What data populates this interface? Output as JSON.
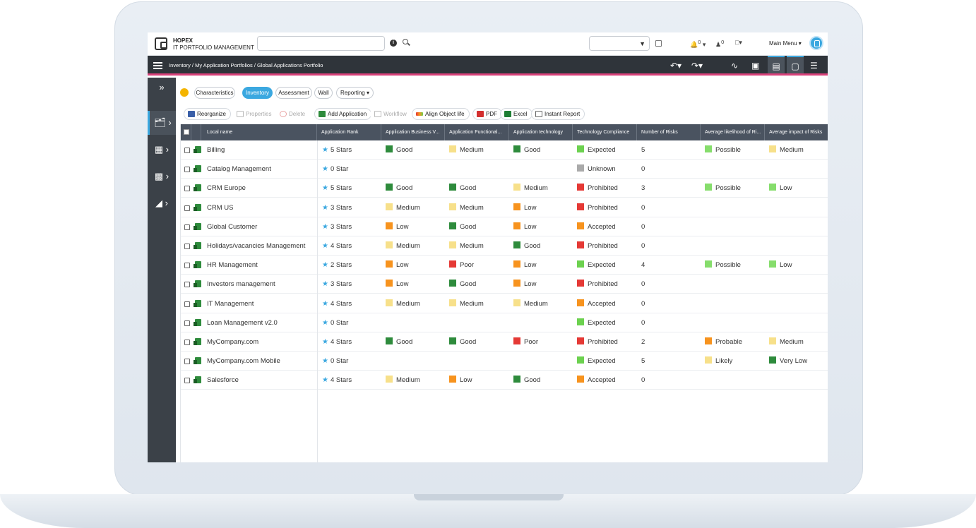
{
  "app": {
    "brand_line1": "HOPEX",
    "brand_line2": "IT PORTFOLIO MANAGEMENT",
    "main_menu": "Main Menu",
    "notif_count": "0",
    "user_count": "0"
  },
  "breadcrumb": "Inventory / My Application Portfolios / Global Applications Portfolio",
  "tabs": [
    {
      "label": "Characteristics"
    },
    {
      "label": "Inventory"
    },
    {
      "label": "Assessment"
    },
    {
      "label": "Wall"
    },
    {
      "label": "Reporting"
    }
  ],
  "toolbar": {
    "reorganize": "Reorganize",
    "properties": "Properties",
    "delete": "Delete",
    "add_application": "Add Application",
    "workflow": "Workflow",
    "align_object_life": "Align Object life",
    "pdf": "PDF",
    "excel": "Excel",
    "instant_report": "Instant Report"
  },
  "columns": [
    "Local name",
    "Application Rank",
    "Application Business V...",
    "Application Functional...",
    "Application technology",
    "Technology Compliance",
    "Number of Risks",
    "Average likelihood of Ri...",
    "Average impact of Risks"
  ],
  "colors": {
    "good": "#2e8b3c",
    "medium": "#f7e08a",
    "low": "#f7931e",
    "poor": "#e53935",
    "expected": "#6cd14f",
    "unknown": "#aaaaaa",
    "prohibited": "#e53935",
    "accepted": "#f7931e",
    "possible": "#86dd6c",
    "probable": "#f7931e",
    "likely": "#f7e08a",
    "very_low": "#2e8b3c",
    "low_impact": "#86dd6c",
    "medium_impact": "#f7e08a"
  },
  "rows": [
    {
      "name": "Billing",
      "rank": "5 Stars",
      "bv": "Good",
      "func": "Medium",
      "tech": "Good",
      "comp": "Expected",
      "risks": "5",
      "lik": "Possible",
      "imp": "Medium"
    },
    {
      "name": "Catalog Management",
      "rank": "0 Star",
      "bv": "",
      "func": "",
      "tech": "",
      "comp": "Unknown",
      "risks": "0",
      "lik": "",
      "imp": ""
    },
    {
      "name": "CRM Europe",
      "rank": "5 Stars",
      "bv": "Good",
      "func": "Good",
      "tech": "Medium",
      "comp": "Prohibited",
      "risks": "3",
      "lik": "Possible",
      "imp": "Low"
    },
    {
      "name": "CRM US",
      "rank": "3 Stars",
      "bv": "Medium",
      "func": "Medium",
      "tech": "Low",
      "comp": "Prohibited",
      "risks": "0",
      "lik": "",
      "imp": ""
    },
    {
      "name": "Global Customer",
      "rank": "3 Stars",
      "bv": "Low",
      "func": "Good",
      "tech": "Low",
      "comp": "Accepted",
      "risks": "0",
      "lik": "",
      "imp": ""
    },
    {
      "name": "Holidays/vacancies Management",
      "rank": "4 Stars",
      "bv": "Medium",
      "func": "Medium",
      "tech": "Good",
      "comp": "Prohibited",
      "risks": "0",
      "lik": "",
      "imp": ""
    },
    {
      "name": "HR Management",
      "rank": "2 Stars",
      "bv": "Low",
      "func": "Poor",
      "tech": "Low",
      "comp": "Expected",
      "risks": "4",
      "lik": "Possible",
      "imp": "Low"
    },
    {
      "name": "Investors management",
      "rank": "3 Stars",
      "bv": "Low",
      "func": "Good",
      "tech": "Low",
      "comp": "Prohibited",
      "risks": "0",
      "lik": "",
      "imp": ""
    },
    {
      "name": "IT Management",
      "rank": "4 Stars",
      "bv": "Medium",
      "func": "Medium",
      "tech": "Medium",
      "comp": "Accepted",
      "risks": "0",
      "lik": "",
      "imp": ""
    },
    {
      "name": "Loan Management v2.0",
      "rank": "0 Star",
      "bv": "",
      "func": "",
      "tech": "",
      "comp": "Expected",
      "risks": "0",
      "lik": "",
      "imp": ""
    },
    {
      "name": "MyCompany.com",
      "rank": "4 Stars",
      "bv": "Good",
      "func": "Good",
      "tech": "Poor",
      "comp": "Prohibited",
      "risks": "2",
      "lik": "Probable",
      "imp": "Medium"
    },
    {
      "name": "MyCompany.com Mobile",
      "rank": "0 Star",
      "bv": "",
      "func": "",
      "tech": "",
      "comp": "Expected",
      "risks": "5",
      "lik": "Likely",
      "imp": "Very Low"
    },
    {
      "name": "Salesforce",
      "rank": "4 Stars",
      "bv": "Medium",
      "func": "Low",
      "tech": "Good",
      "comp": "Accepted",
      "risks": "0",
      "lik": "",
      "imp": ""
    }
  ]
}
